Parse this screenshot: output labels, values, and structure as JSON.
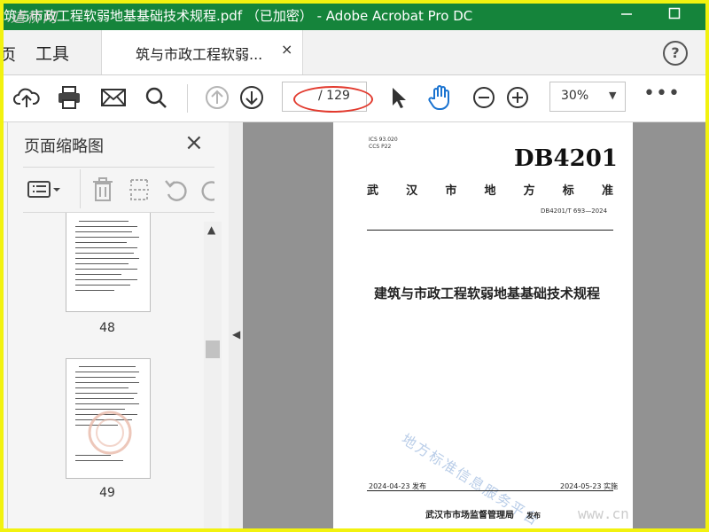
{
  "window": {
    "title": "筑与市政工程软弱地基基础技术规程.pdf （已加密） - Adobe Acrobat Pro DC",
    "overlay_watermark": "道桥网"
  },
  "tabs": {
    "home": "页",
    "tools": "工具",
    "document": "筑与市政工程软弱...",
    "close": "×",
    "help": "?"
  },
  "toolbar": {
    "current_page": "",
    "total_pages": "/ 129",
    "zoom": "30%",
    "more": "•••"
  },
  "thumbnails_pane": {
    "title": "页面缩略图",
    "close": "×",
    "pages": [
      {
        "number": "48"
      },
      {
        "number": "49"
      }
    ]
  },
  "document": {
    "ics": "ICS  93.020",
    "ccs": "CCS  P22",
    "db_code": "DB4201",
    "authority_chars": [
      "武",
      "汉",
      "市",
      "地",
      "方",
      "标",
      "准"
    ],
    "standard_number": "DB4201/T 693—2024",
    "title": "建筑与市政工程软弱地基基础技术规程",
    "watermark": "地方标准信息服务平台",
    "published": "2024-04-23 发布",
    "implemented": "2024-05-23 实施",
    "issuer": "武汉市市场监督管理局",
    "issuer_suffix": "发布"
  },
  "site_watermark": "www.cn",
  "colors": {
    "titlebar": "#15843b",
    "frame": "#f2f20f",
    "annotation": "#e23a2e",
    "canvas": "#929292"
  }
}
